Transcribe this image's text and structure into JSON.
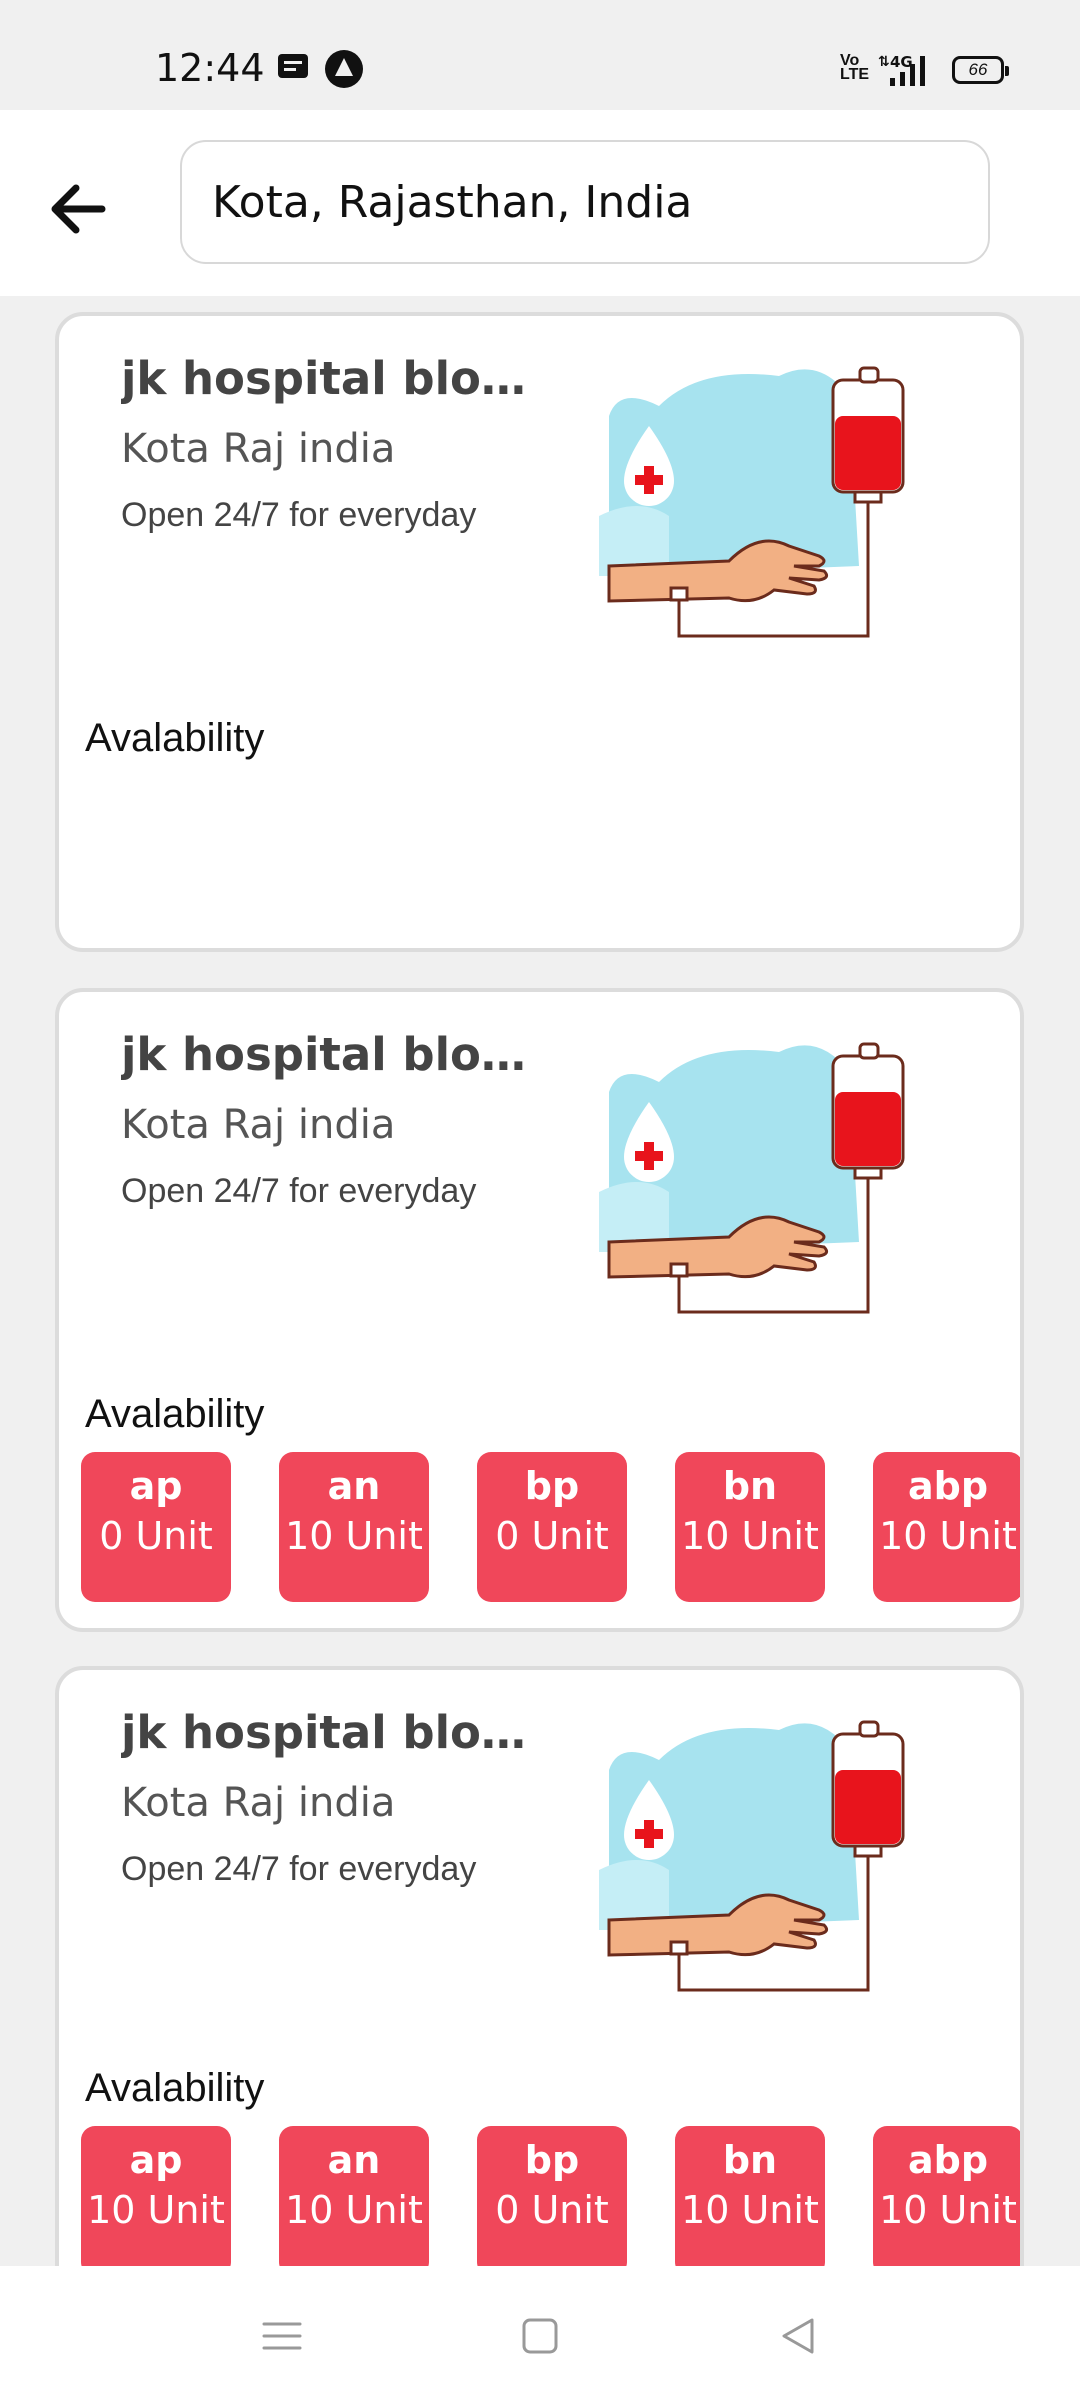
{
  "status_bar": {
    "time": "12:44",
    "volte": "Vo LTE",
    "network": "4G",
    "battery": "66"
  },
  "search": {
    "value": "Kota, Rajasthan, India"
  },
  "cards": [
    {
      "title": "jk hospital blood...",
      "location": "Kota Raj india",
      "hours": "Open 24/7 for everyday",
      "availability_label": "Avalability",
      "groups": []
    },
    {
      "title": "jk hospital blood...",
      "location": "Kota Raj india",
      "hours": "Open 24/7 for everyday",
      "availability_label": "Avalability",
      "groups": [
        {
          "type": "ap",
          "units": "0 Unit"
        },
        {
          "type": "an",
          "units": "10 Unit"
        },
        {
          "type": "bp",
          "units": "0 Unit"
        },
        {
          "type": "bn",
          "units": "10 Unit"
        },
        {
          "type": "abp",
          "units": "10 Unit"
        }
      ]
    },
    {
      "title": "jk hospital blood...",
      "location": "Kota Raj india",
      "hours": "Open 24/7 for everyday",
      "availability_label": "Avalability",
      "groups": [
        {
          "type": "ap",
          "units": "10 Unit"
        },
        {
          "type": "an",
          "units": "10 Unit"
        },
        {
          "type": "bp",
          "units": "0 Unit"
        },
        {
          "type": "bn",
          "units": "10 Unit"
        },
        {
          "type": "abp",
          "units": "10 Unit"
        }
      ]
    }
  ],
  "colors": {
    "chip": "#f0475a",
    "accent_blood": "#e8141c",
    "sky": "#a7e3ef"
  },
  "icons": {
    "back": "arrow-left-icon",
    "illustration": "blood-transfusion-illustration",
    "nav": [
      "menu-icon",
      "home-square-icon",
      "back-triangle-icon"
    ]
  }
}
